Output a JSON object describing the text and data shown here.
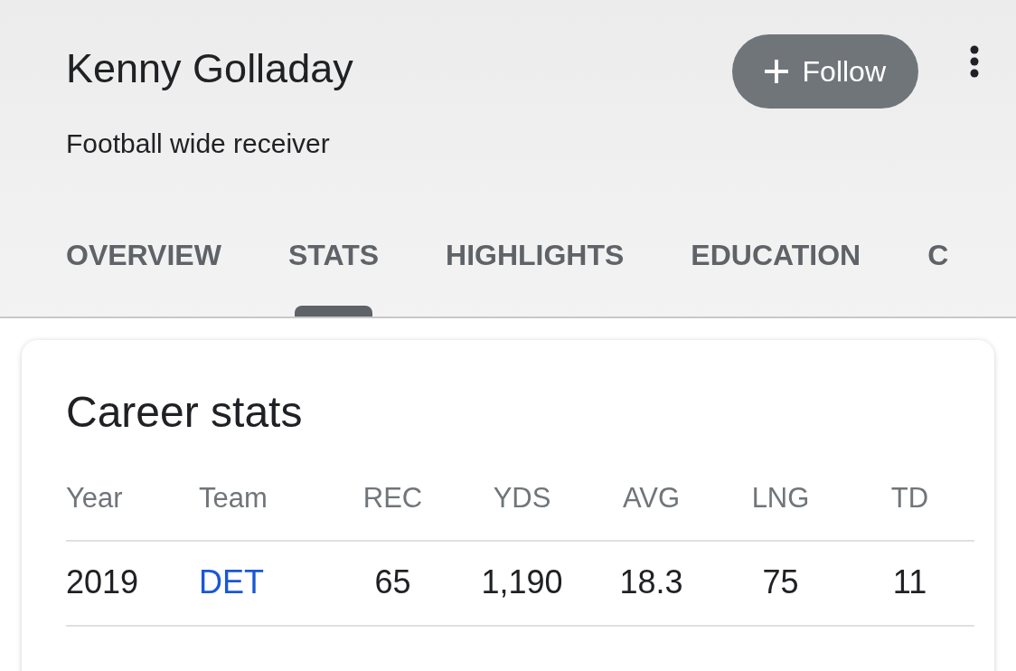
{
  "profile": {
    "name": "Kenny Golladay",
    "subtitle": "Football wide receiver",
    "follow_button": "Follow"
  },
  "tabs": [
    {
      "label": "OVERVIEW",
      "selected": false
    },
    {
      "label": "STATS",
      "selected": true
    },
    {
      "label": "HIGHLIGHTS",
      "selected": false
    },
    {
      "label": "EDUCATION",
      "selected": false
    },
    {
      "label": "C",
      "selected": false
    }
  ],
  "card": {
    "title": "Career stats",
    "columns": [
      "Year",
      "Team",
      "REC",
      "YDS",
      "AVG",
      "LNG",
      "TD"
    ],
    "rows": [
      {
        "cells": [
          "2019",
          "DET",
          "65",
          "1,190",
          "18.3",
          "75",
          "11"
        ]
      }
    ]
  }
}
